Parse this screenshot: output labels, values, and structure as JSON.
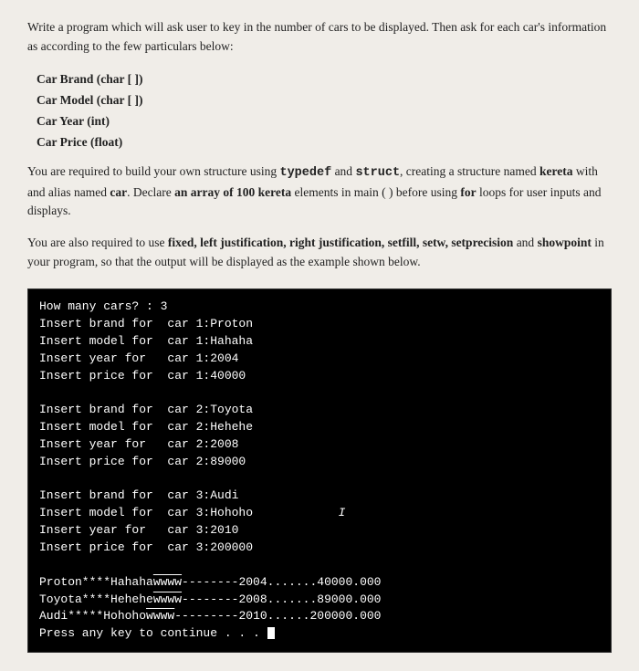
{
  "description": "Programming assignment page with terminal output",
  "intro": {
    "paragraph": "Write a program which will ask user to key in the number of cars to be displayed. Then ask for each car's information as according to the few particulars below:"
  },
  "car_fields": [
    "Car Brand (char [ ])",
    "Car Model (char [ ])",
    "Car Year (int)",
    "Car Price (float)"
  ],
  "paragraph2": "You are required to build your own structure using typedef and struct, creating a structure named kereta with and alias named car. Declare an array of 100 kereta elements in main ( ) before using for loops for user inputs and displays.",
  "paragraph3": "You are also required to use fixed, left justification, right justification, setfill, setw, setprecision and showpoint in your program, so that your output will be displayed as the example shown below.",
  "terminal": {
    "lines": [
      "How many cars? : 3",
      "Insert brand for  car 1:Proton",
      "Insert model for  car 1:Hahaha",
      "Insert year for   car 1:2004",
      "Insert price for  car 1:40000",
      "",
      "Insert brand for  car 2:Toyota",
      "Insert model for  car 2:Hehehe",
      "Insert year for   car 2:2008",
      "Insert price for  car 2:89000",
      "",
      "Insert brand for  car 3:Audi",
      "Insert model for  car 3:Hohoho",
      "Insert year for   car 3:2010",
      "Insert price for  car 3:200000",
      "",
      "Proton****Hahahaˆˆˆˆ--------2004.......40000.000",
      "Toyota****Heheheˆˆˆˆ--------2008.......89000.000",
      "Audi*****Hohohoˆˆˆˆ--------2010......200000.000",
      "Press any key to continue . . . _"
    ]
  }
}
